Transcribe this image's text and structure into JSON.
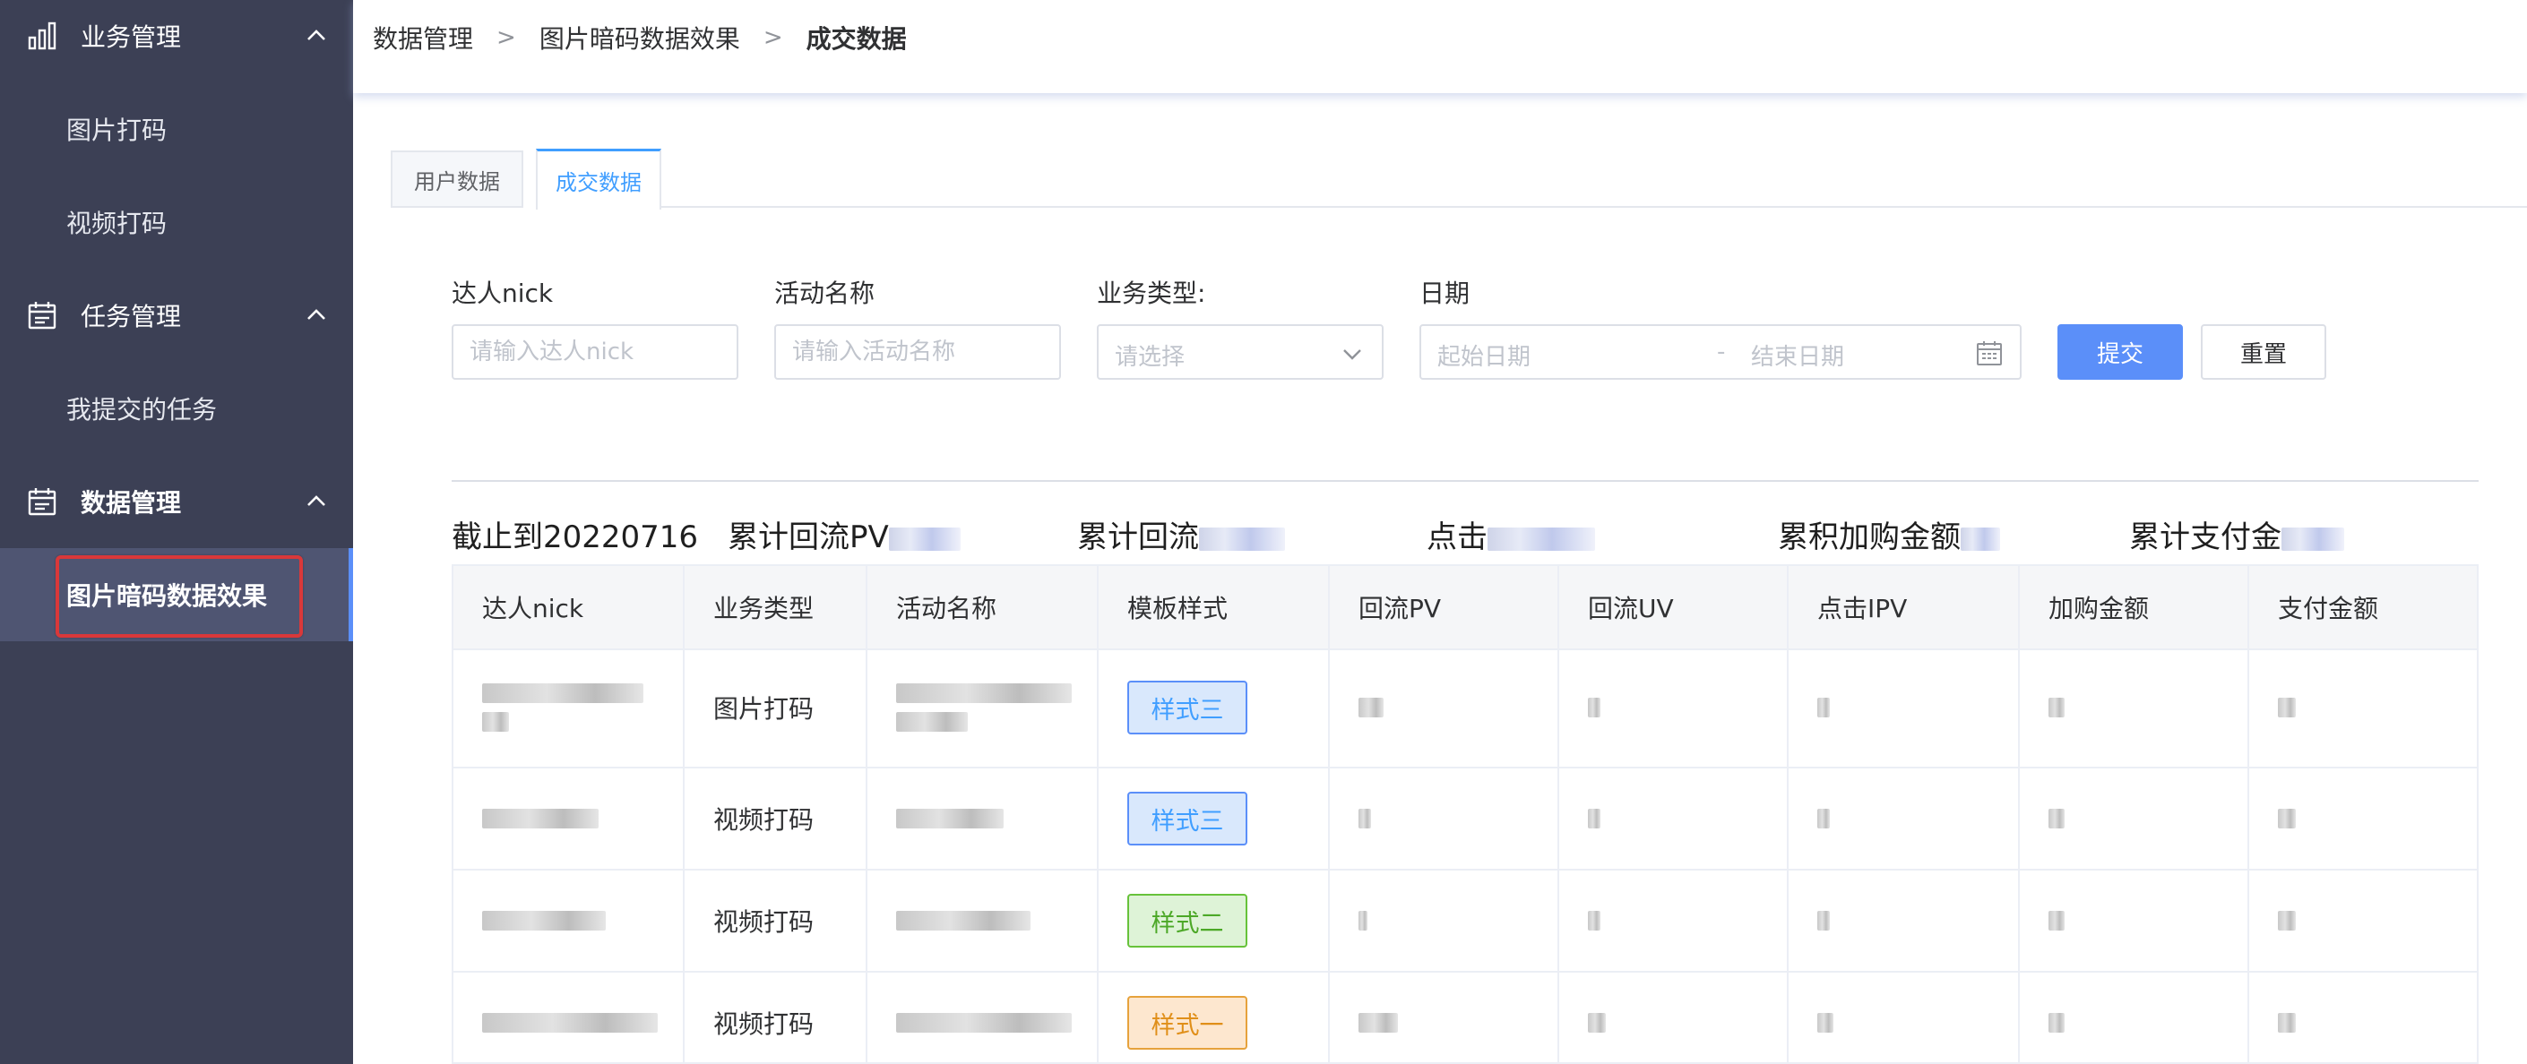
{
  "sidebar": {
    "groups": [
      {
        "label": "业务管理",
        "icon": "bar-chart-icon"
      },
      {
        "label": "任务管理",
        "icon": "calendar-icon"
      },
      {
        "label": "数据管理",
        "icon": "calendar-icon"
      }
    ],
    "items": [
      {
        "label": "图片打码"
      },
      {
        "label": "视频打码"
      },
      {
        "label": "我提交的任务"
      },
      {
        "label": "图片暗码数据效果",
        "active": true
      }
    ]
  },
  "breadcrumb": {
    "items": [
      "数据管理",
      "图片暗码数据效果"
    ],
    "current": "成交数据",
    "separator": ">"
  },
  "tabs": [
    {
      "label": "用户数据",
      "active": false
    },
    {
      "label": "成交数据",
      "active": true
    }
  ],
  "filters": {
    "nick": {
      "label": "达人nick",
      "placeholder": "请输入达人nick"
    },
    "activity": {
      "label": "活动名称",
      "placeholder": "请输入活动名称"
    },
    "biz_type": {
      "label": "业务类型:",
      "placeholder": "请选择"
    },
    "date": {
      "label": "日期",
      "start_placeholder": "起始日期",
      "separator": "-",
      "end_placeholder": "结束日期"
    }
  },
  "buttons": {
    "submit": "提交",
    "reset": "重置"
  },
  "summary": {
    "as_of": "截止到20220716",
    "pv": "累计回流PV",
    "uv": "累计回流",
    "click": "点击",
    "cart": "累积加购金额",
    "pay": "累计支付金"
  },
  "table": {
    "columns": [
      "达人nick",
      "业务类型",
      "活动名称",
      "模板样式",
      "回流PV",
      "回流UV",
      "点击IPV",
      "加购金额",
      "支付金额"
    ],
    "rows": [
      {
        "biz_type": "图片打码",
        "style": "样式三",
        "style_color": "blue"
      },
      {
        "biz_type": "视频打码",
        "style": "样式三",
        "style_color": "blue"
      },
      {
        "biz_type": "视频打码",
        "style": "样式二",
        "style_color": "green"
      },
      {
        "biz_type": "视频打码",
        "style": "样式一",
        "style_color": "orange"
      }
    ]
  },
  "colors": {
    "sidebar_bg": "#3c4055",
    "primary": "#5b8ff9",
    "highlight": "#d9383a"
  }
}
